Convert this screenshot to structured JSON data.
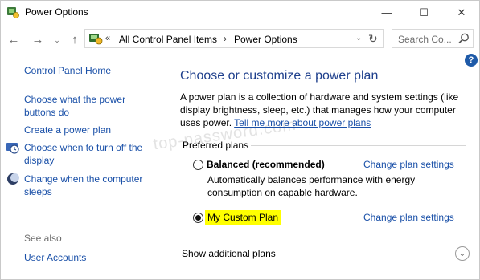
{
  "window": {
    "title": "Power Options",
    "minimize_glyph": "—",
    "maximize_glyph": "☐",
    "close_glyph": "✕"
  },
  "nav": {
    "back_glyph": "←",
    "forward_glyph": "→",
    "recent_glyph": "⌄",
    "up_glyph": "↑"
  },
  "address": {
    "overflow": "«",
    "crumbs": [
      "All Control Panel Items",
      "Power Options"
    ],
    "separator": "›",
    "dropdown_glyph": "⌄",
    "refresh_glyph": "↻"
  },
  "search": {
    "placeholder": "Search Co..."
  },
  "help": {
    "glyph": "?"
  },
  "sidebar": {
    "home": "Control Panel Home",
    "links": [
      "Choose what the power buttons do",
      "Create a power plan",
      "Choose when to turn off the display",
      "Change when the computer sleeps"
    ],
    "see_also_label": "See also",
    "see_also_links": [
      "User Accounts"
    ]
  },
  "main": {
    "title": "Choose or customize a power plan",
    "description": "A power plan is a collection of hardware and system settings (like display brightness, sleep, etc.) that manages how your computer uses power.",
    "description_link": "Tell me more about power plans",
    "preferred_label": "Preferred plans",
    "plans": [
      {
        "name": "Balanced (recommended)",
        "description": "Automatically balances performance with energy consumption on capable hardware.",
        "selected": false,
        "link": "Change plan settings"
      },
      {
        "name": "My Custom Plan",
        "selected": true,
        "link": "Change plan settings"
      }
    ],
    "show_more": "Show additional plans",
    "show_more_glyph": "⌄"
  },
  "watermark": "top-password.com",
  "colors": {
    "link": "#1a50a8",
    "title": "#1e3f8c",
    "highlight": "#ffff00"
  }
}
